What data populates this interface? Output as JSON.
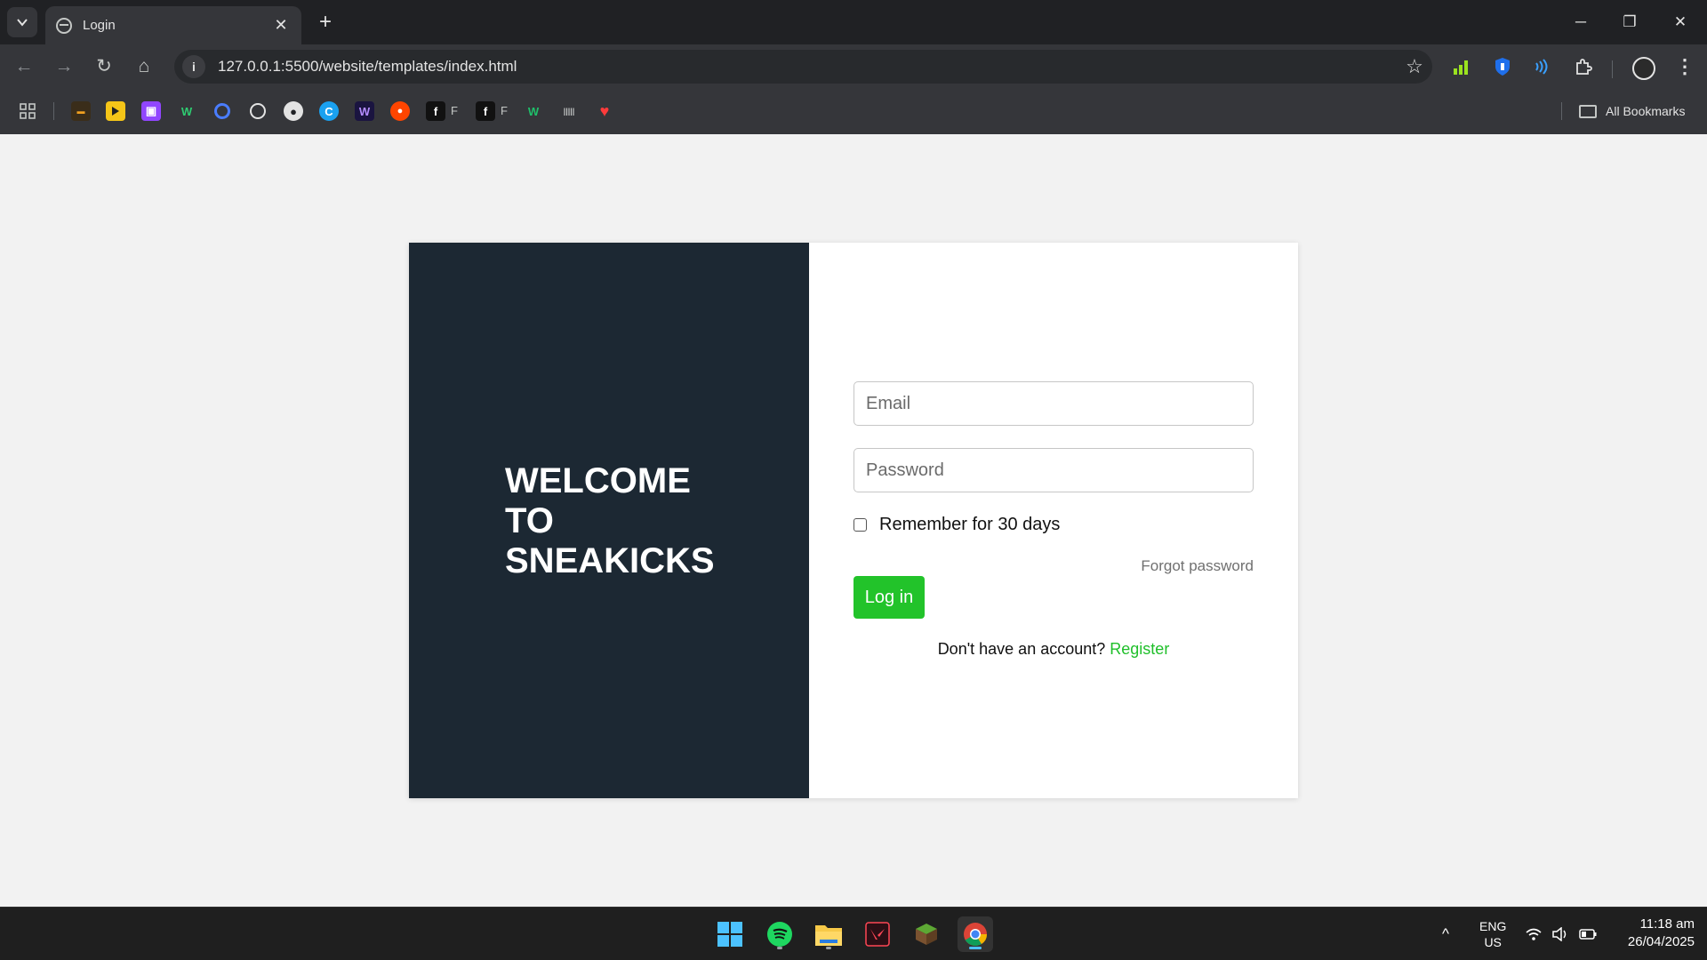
{
  "browser": {
    "tab": {
      "title": "Login",
      "close_glyph": "✕"
    },
    "new_tab_glyph": "+",
    "window_controls": {
      "minimize": "─",
      "restore": "❐",
      "close": "✕"
    },
    "nav": {
      "back": "←",
      "forward": "→",
      "reload": "↻",
      "home": "⌂"
    },
    "url": "127.0.0.1:5500/website/templates/index.html",
    "star_glyph": "☆",
    "menu_glyph": "⋮",
    "bookmarks": {
      "items": [
        {
          "icon": "apps-grid-icon"
        },
        {
          "icon": "bookmark-icon-1"
        },
        {
          "icon": "youtube-icon"
        },
        {
          "icon": "twitch-icon"
        },
        {
          "icon": "w-icon"
        },
        {
          "icon": "q-icon"
        },
        {
          "icon": "openai-icon"
        },
        {
          "icon": "github-icon"
        },
        {
          "icon": "c-icon"
        },
        {
          "icon": "w-dark-icon"
        },
        {
          "icon": "reddit-icon"
        },
        {
          "icon": "f-icon",
          "label": "F"
        },
        {
          "icon": "f-icon",
          "label": "F"
        },
        {
          "icon": "w-green-icon"
        },
        {
          "icon": "cisco-icon"
        },
        {
          "icon": "heart-icon"
        }
      ],
      "all_bookmarks_label": "All Bookmarks"
    }
  },
  "page": {
    "welcome_lines": [
      "WELCOME",
      "TO",
      "SNEAKICKS"
    ],
    "form": {
      "email_placeholder": "Email",
      "password_placeholder": "Password",
      "remember_label": "Remember for 30 days",
      "forgot_label": "Forgot password",
      "login_label": "Log in",
      "signup_prompt": "Don't have an account?",
      "register_label": "Register"
    },
    "colors": {
      "panel_dark": "#1c2833",
      "accent_green": "#22c32a"
    }
  },
  "taskbar": {
    "apps": [
      "windows-start-icon",
      "spotify-icon",
      "file-explorer-icon",
      "valorant-icon",
      "minecraft-icon",
      "chrome-icon"
    ],
    "tray": {
      "chevron": "^",
      "language_line1": "ENG",
      "language_line2": "US",
      "time": "11:18 am",
      "date": "26/04/2025"
    }
  }
}
